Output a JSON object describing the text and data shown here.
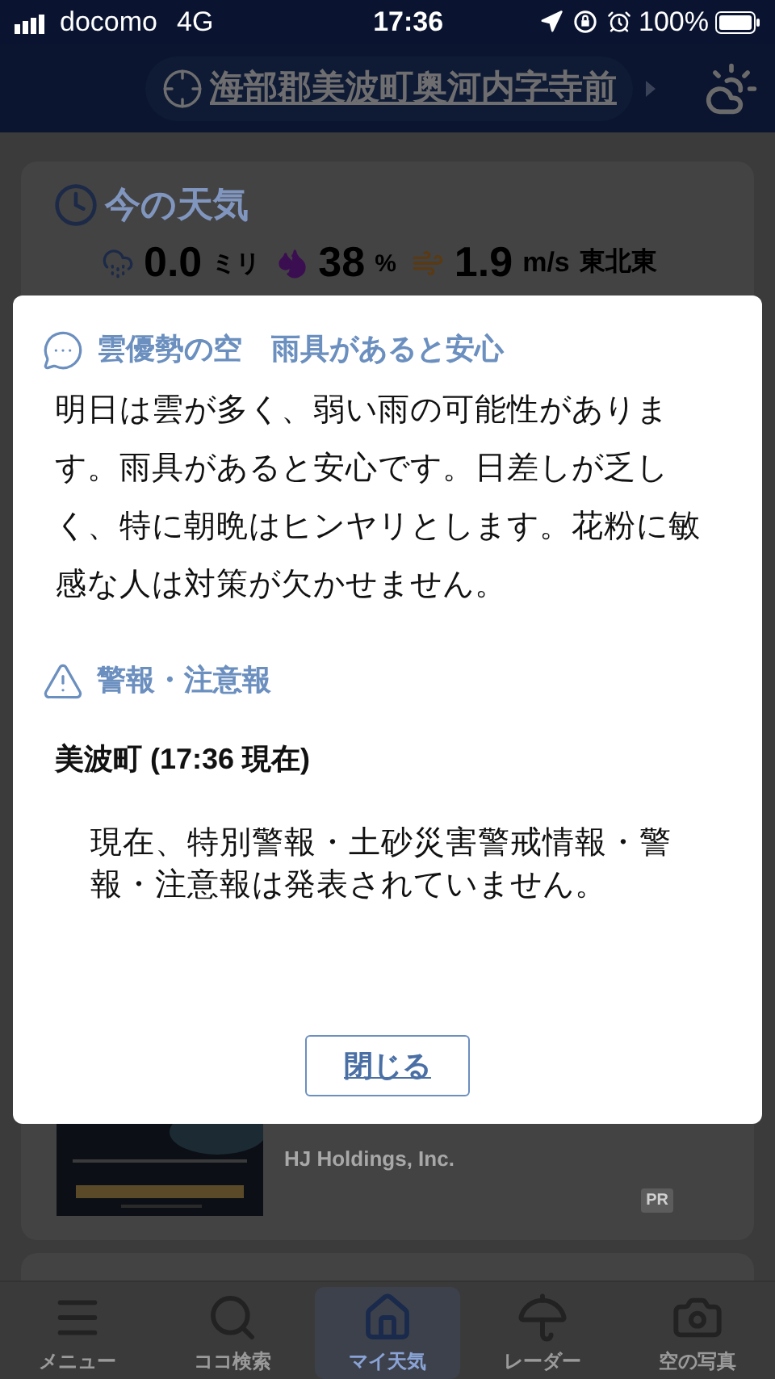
{
  "status_bar": {
    "carrier": "docomo",
    "network": "4G",
    "time": "17:36",
    "battery": "100%"
  },
  "header": {
    "location": "海部郡美波町奥河内字寺前"
  },
  "current_weather": {
    "title": "今の天気",
    "rain": {
      "value": "0.0",
      "unit": "ミリ"
    },
    "humidity": {
      "value": "38",
      "unit": "%"
    },
    "wind": {
      "value": "1.9",
      "unit": "m/s",
      "direction": "東北東"
    }
  },
  "dialog": {
    "comment_title": "雲優勢の空　雨具があると安心",
    "comment": "明日は雲が多く、弱い雨の可能性があります。雨具があると安心です。日差しが乏しく、特に朝晩はヒンヤリとします。花粉に敏感な人は対策が欠かせません。",
    "warnings_title": "警報・注意報",
    "area": "美波町 (17:36 現在)",
    "warnings_message": "現在、特別警報・土砂災害警戒情報・警報・注意報は発表されていません。",
    "close_button": "閉じる"
  },
  "ad": {
    "kind": "picture",
    "advertiser": "HJ Holdings, Inc.",
    "badge": "PR"
  },
  "tabs": [
    {
      "label": "メニュー",
      "selected": false
    },
    {
      "label": "ココ検索",
      "selected": false
    },
    {
      "label": "マイ天気",
      "selected": true
    },
    {
      "label": "レーダー",
      "selected": false
    },
    {
      "label": "空の写真",
      "selected": false
    }
  ]
}
